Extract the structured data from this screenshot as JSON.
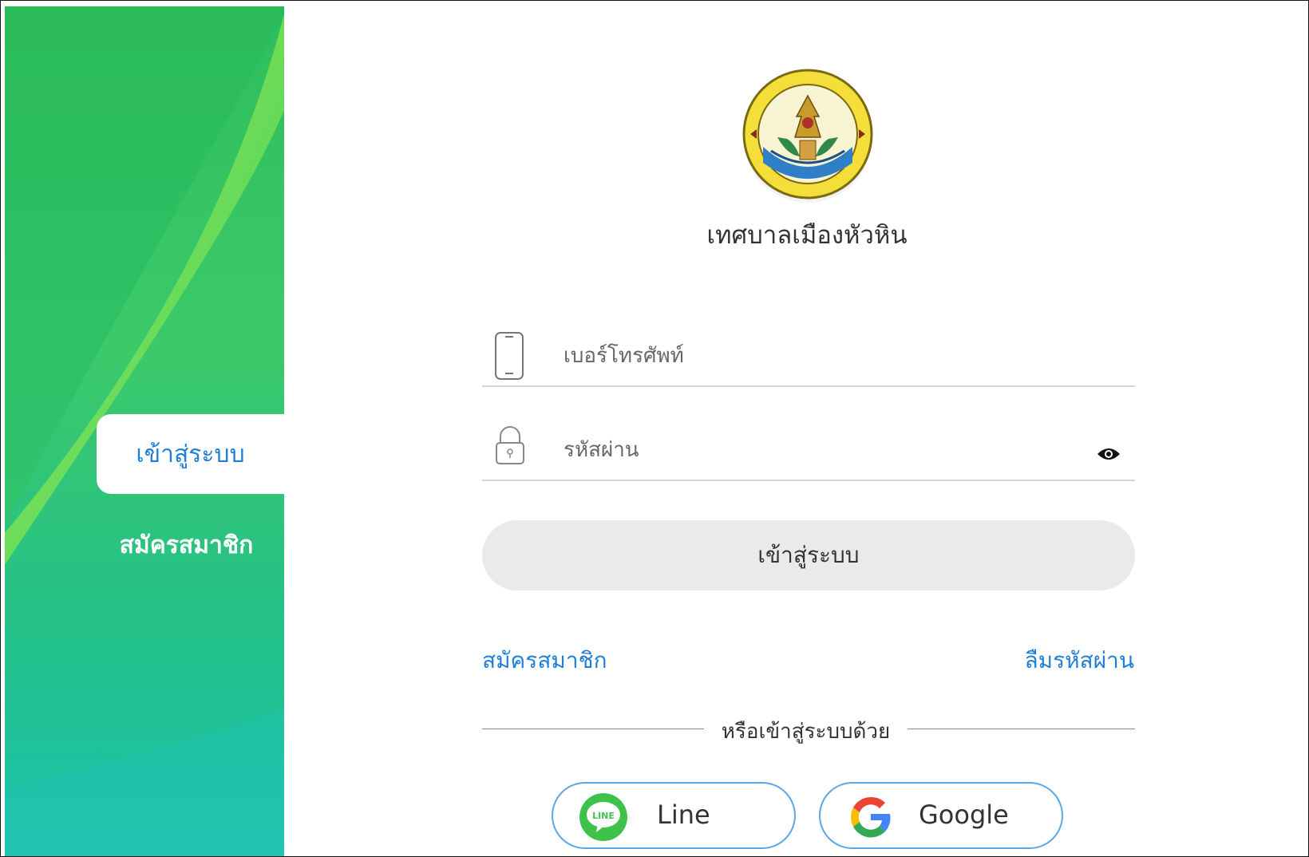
{
  "sidebar": {
    "tabs": [
      {
        "label": "เข้าสู่ระบบ",
        "active": true
      },
      {
        "label": "สมัครสมาชิก",
        "active": false
      }
    ]
  },
  "header": {
    "org_name": "เทศบาลเมืองหัวหิน",
    "logo_icon": "municipality-seal-icon"
  },
  "form": {
    "phone_placeholder": "เบอร์โทรศัพท์",
    "phone_value": "",
    "password_placeholder": "รหัสผ่าน",
    "password_value": "",
    "login_label": "เข้าสู่ระบบ",
    "register_link": "สมัครสมาชิก",
    "forgot_link": "ลืมรหัสผ่าน"
  },
  "divider": {
    "text": "หรือเข้าสู่ระบบด้วย"
  },
  "social": {
    "line_label": "Line",
    "google_label": "Google"
  },
  "colors": {
    "accent": "#1e7fd9",
    "green_light": "#9be83a",
    "green": "#2fbe5c",
    "teal": "#1fc3b0",
    "line_green": "#06c755"
  }
}
